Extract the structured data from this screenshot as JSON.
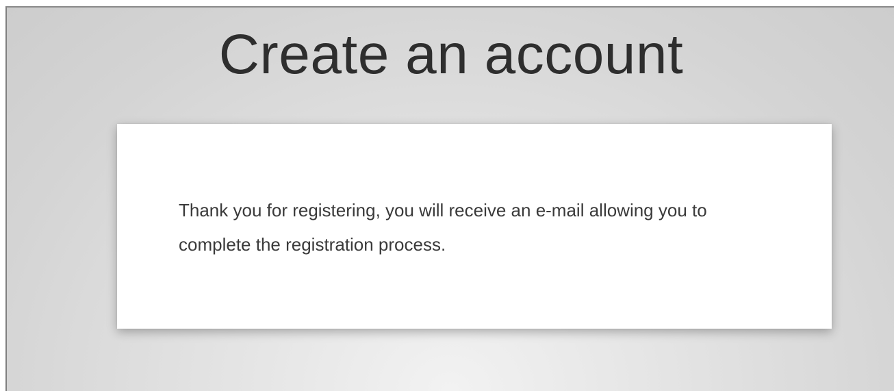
{
  "page": {
    "title": "Create an account"
  },
  "confirmation": {
    "message": "Thank you for registering, you will receive an e-mail allowing you to complete the registration process."
  },
  "colors": {
    "background": "#d9d9d9",
    "panel": "#ffffff",
    "title_text": "#2e2e2e",
    "body_text": "#3a3a3a"
  }
}
